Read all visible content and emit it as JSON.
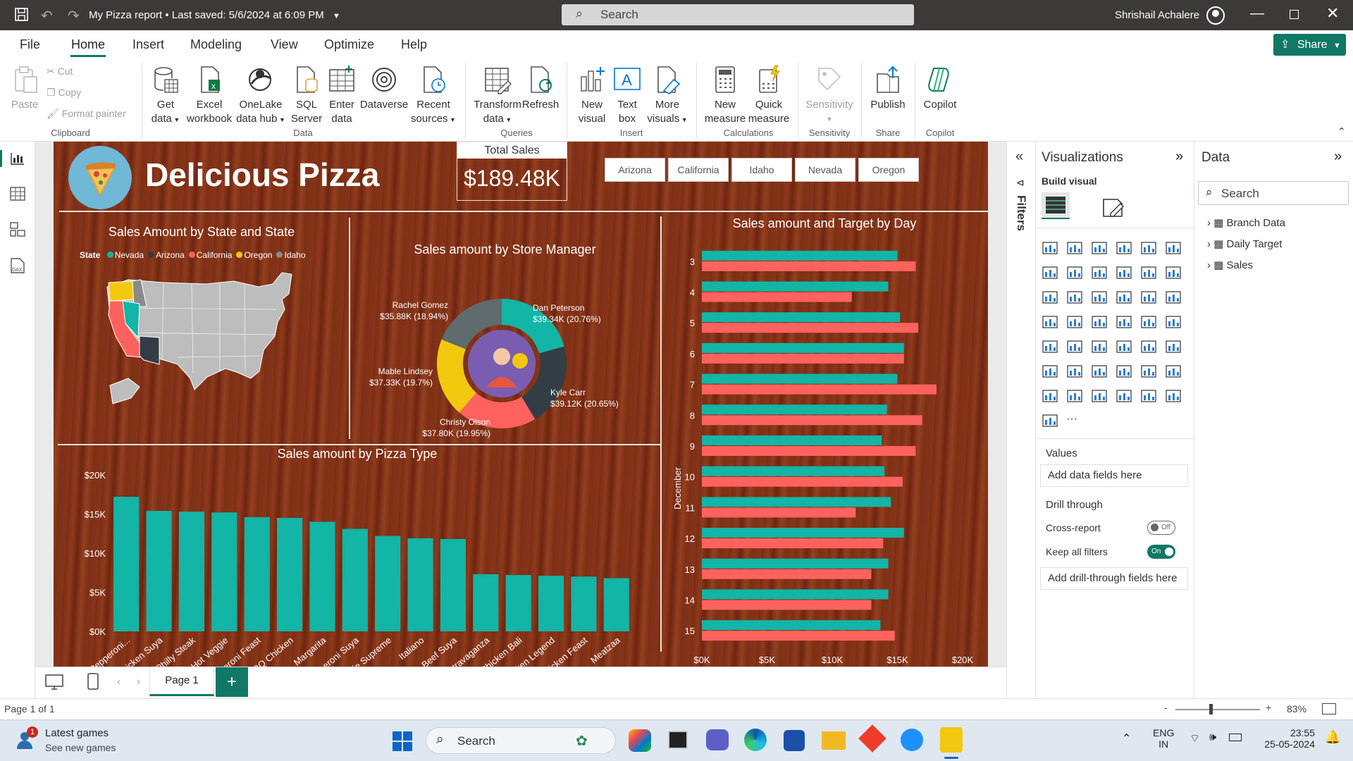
{
  "titlebar": {
    "title": "My Pizza report",
    "saved": "Last saved: 5/6/2024 at 6:09 PM",
    "search_placeholder": "Search",
    "user": "Shrishail Achalere"
  },
  "menu": {
    "items": [
      "File",
      "Home",
      "Insert",
      "Modeling",
      "View",
      "Optimize",
      "Help"
    ],
    "active": "Home",
    "share": "Share"
  },
  "ribbon": {
    "clipboard": {
      "paste": "Paste",
      "cut": "Cut",
      "copy": "Copy",
      "format_painter": "Format painter",
      "group": "Clipboard"
    },
    "data": {
      "get_data": [
        "Get",
        "data"
      ],
      "excel": [
        "Excel",
        "workbook"
      ],
      "onelake": [
        "OneLake",
        "data hub"
      ],
      "sql": [
        "SQL",
        "Server"
      ],
      "enter": [
        "Enter",
        "data"
      ],
      "dataverse": "Dataverse",
      "recent": [
        "Recent",
        "sources"
      ],
      "group": "Data"
    },
    "queries": {
      "transform": [
        "Transform",
        "data"
      ],
      "refresh": "Refresh",
      "group": "Queries"
    },
    "insert": {
      "new_visual": [
        "New",
        "visual"
      ],
      "text_box": [
        "Text",
        "box"
      ],
      "more_visuals": [
        "More",
        "visuals"
      ],
      "group": "Insert"
    },
    "calculations": {
      "new_measure": [
        "New",
        "measure"
      ],
      "quick_measure": [
        "Quick",
        "measure"
      ],
      "group": "Calculations"
    },
    "sensitivity": {
      "label": "Sensitivity",
      "group": "Sensitivity"
    },
    "share": {
      "publish": "Publish",
      "group": "Share"
    },
    "copilot": {
      "label": "Copilot",
      "group": "Copilot"
    }
  },
  "report": {
    "title": "Delicious Pizza",
    "card": {
      "label": "Total Sales",
      "value": "$189.48K"
    },
    "slicers": [
      "Arizona",
      "California",
      "Idaho",
      "Nevada",
      "Oregon"
    ],
    "map": {
      "title": "Sales Amount by State and State",
      "legend_title": "State",
      "legend": [
        {
          "name": "Nevada",
          "color": "#12b5a6"
        },
        {
          "name": "Arizona",
          "color": "#333d45"
        },
        {
          "name": "California",
          "color": "#fd625e"
        },
        {
          "name": "Oregon",
          "color": "#f2c80f"
        },
        {
          "name": "Idaho",
          "color": "#8a8a8a"
        }
      ]
    },
    "donut": {
      "title": "Sales amount by Store Manager"
    },
    "pizza": {
      "title": "Sales amount by Pizza Type"
    },
    "day": {
      "title": "Sales amount and Target by Day",
      "ylabel": "December"
    }
  },
  "chart_data": [
    {
      "type": "pie",
      "title": "Sales amount by Store Manager",
      "slices": [
        {
          "name": "Dan Peterson",
          "value": 39.34,
          "label": "$39.34K (20.76%)",
          "color": "#12b5a6"
        },
        {
          "name": "Kyle Carr",
          "value": 39.12,
          "label": "$39.12K (20.65%)",
          "color": "#333d45"
        },
        {
          "name": "Christy Olson",
          "value": 37.8,
          "label": "$37.80K (19.95%)",
          "color": "#fd625e"
        },
        {
          "name": "Mable Lindsey",
          "value": 37.33,
          "label": "$37.33K (19.7%)",
          "color": "#f2c80f"
        },
        {
          "name": "Rachel Gomez",
          "value": 35.88,
          "label": "$35.88K (18.94%)",
          "color": "#5f6b6d"
        }
      ]
    },
    {
      "type": "bar",
      "title": "Sales amount by Pizza Type",
      "categories": [
        "Hot Pepperoni...",
        "Chicken Suya",
        "BBQ Philly Steak",
        "Hot Veggie",
        "Pepperoni Feast",
        "BBQ Chicken",
        "Margarita",
        "Pepperoni Suya",
        "Veggie Supreme",
        "Italiano",
        "Beef Suya",
        "Extravaganza",
        "Chicken Bali",
        "Chicken Legend",
        "Chicken Feast",
        "Meatzaa"
      ],
      "values": [
        17.2,
        15.4,
        15.3,
        15.2,
        14.6,
        14.5,
        14.0,
        13.1,
        12.2,
        11.9,
        11.8,
        7.3,
        7.2,
        7.1,
        7.0,
        6.8
      ],
      "yticks": [
        "$0K",
        "$5K",
        "$10K",
        "$15K",
        "$20K"
      ],
      "ylim": [
        0,
        20
      ],
      "color": "#12b5a6"
    },
    {
      "type": "bar",
      "orientation": "horizontal",
      "title": "Sales amount and Target by Day",
      "categories": [
        "3",
        "4",
        "5",
        "6",
        "7",
        "8",
        "9",
        "10",
        "11",
        "12",
        "13",
        "14",
        "15"
      ],
      "series": [
        {
          "values": [
            15.0,
            14.3,
            15.2,
            15.5,
            15.0,
            14.2,
            13.8,
            14.0,
            14.5,
            15.5,
            14.3,
            14.3,
            13.7
          ],
          "color": "#12b5a6"
        },
        {
          "values": [
            16.4,
            11.5,
            16.6,
            15.5,
            18.0,
            16.9,
            16.4,
            15.4,
            11.8,
            13.9,
            13.0,
            13.0,
            14.8
          ],
          "color": "#fd625e"
        }
      ],
      "xticks": [
        "$0K",
        "$5K",
        "$10K",
        "$15K",
        "$20K"
      ],
      "xlim": [
        0,
        20
      ],
      "ylabel": "December"
    }
  ],
  "visualizations": {
    "title": "Visualizations",
    "build": "Build visual",
    "values": "Values",
    "add_data": "Add data fields here",
    "drill": "Drill through",
    "cross": "Cross-report",
    "cross_state": "Off",
    "keep": "Keep all filters",
    "keep_state": "On",
    "add_drill": "Add drill-through fields here"
  },
  "filters": {
    "label": "Filters"
  },
  "data_pane": {
    "title": "Data",
    "search": "Search",
    "tables": [
      "Branch Data",
      "Daily Target",
      "Sales"
    ]
  },
  "pages": {
    "tab": "Page 1"
  },
  "status": {
    "page": "Page 1 of 1",
    "zoom": "83%"
  },
  "taskbar": {
    "news_title": "Latest games",
    "news_sub": "See new games",
    "badge": "1",
    "search": "Search",
    "lang1": "ENG",
    "lang2": "IN",
    "time": "23:55",
    "date": "25-05-2024"
  }
}
